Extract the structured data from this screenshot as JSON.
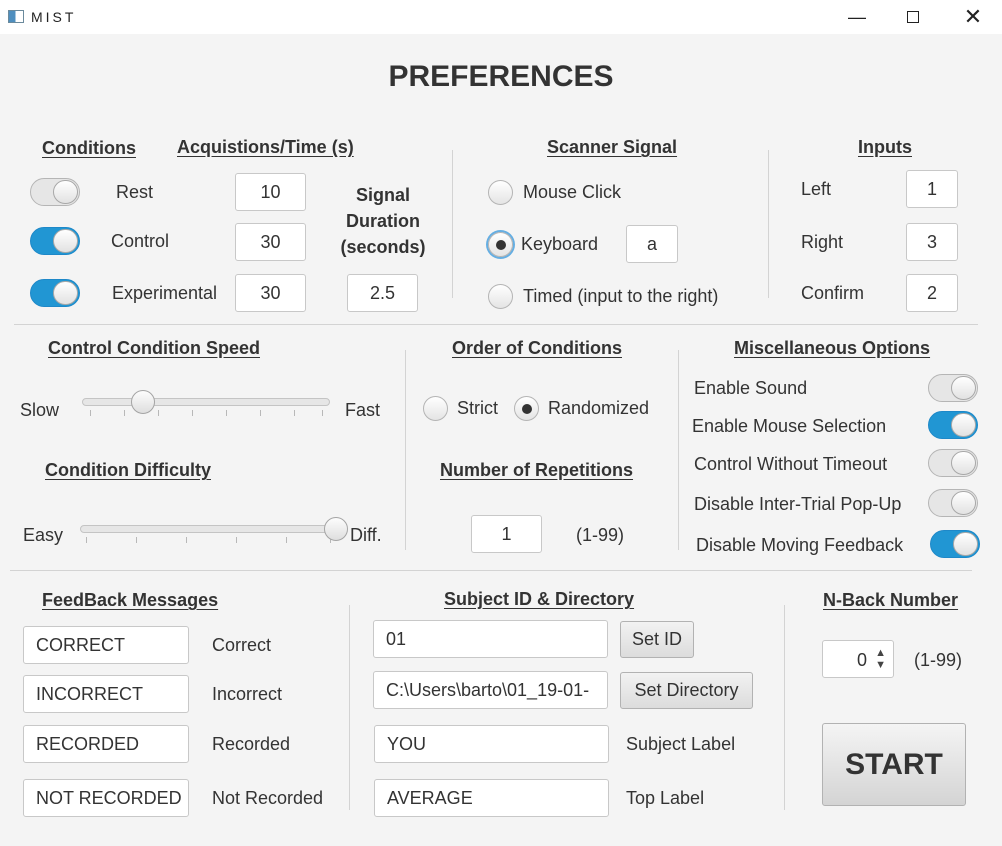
{
  "window": {
    "title": "MIST"
  },
  "page_title": "PREFERENCES",
  "conditions": {
    "heading": "Conditions",
    "acq_heading": "Acquistions/Time (s)",
    "rows": [
      {
        "label": "Rest",
        "value": "10",
        "enabled": false
      },
      {
        "label": "Control",
        "value": "30",
        "enabled": true
      },
      {
        "label": "Experimental",
        "value": "30",
        "enabled": true
      }
    ],
    "signal_duration_label": [
      "Signal",
      "Duration",
      "(seconds)"
    ],
    "signal_duration_value": "2.5"
  },
  "scanner_signal": {
    "heading": "Scanner Signal",
    "options": [
      "Mouse Click",
      "Keyboard",
      "Timed (input to the right)"
    ],
    "selected": "Keyboard",
    "keyboard_key": "a"
  },
  "inputs": {
    "heading": "Inputs",
    "rows": [
      {
        "label": "Left",
        "value": "1"
      },
      {
        "label": "Right",
        "value": "3"
      },
      {
        "label": "Confirm",
        "value": "2"
      }
    ]
  },
  "speed": {
    "heading": "Control Condition Speed",
    "min_label": "Slow",
    "max_label": "Fast",
    "value_fraction": 0.22
  },
  "difficulty": {
    "heading": "Condition Difficulty",
    "min_label": "Easy",
    "max_label": "Diff.",
    "value_fraction": 1.0
  },
  "order": {
    "heading": "Order of Conditions",
    "options": [
      "Strict",
      "Randomized"
    ],
    "selected": "Randomized"
  },
  "repetitions": {
    "heading": "Number of Repetitions",
    "value": "1",
    "range": "(1-99)"
  },
  "misc": {
    "heading": "Miscellaneous Options",
    "options": [
      {
        "label": "Enable Sound",
        "enabled": false
      },
      {
        "label": "Enable Mouse Selection",
        "enabled": true
      },
      {
        "label": "Control Without Timeout",
        "enabled": false
      },
      {
        "label": "Disable Inter-Trial Pop-Up",
        "enabled": false
      },
      {
        "label": "Disable Moving Feedback",
        "enabled": true
      }
    ]
  },
  "feedback": {
    "heading": "FeedBack Messages",
    "rows": [
      {
        "value": "CORRECT",
        "label": "Correct"
      },
      {
        "value": "INCORRECT",
        "label": "Incorrect"
      },
      {
        "value": "RECORDED",
        "label": "Recorded"
      },
      {
        "value": "NOT RECORDED",
        "label": "Not Recorded"
      }
    ]
  },
  "subject": {
    "heading": "Subject ID & Directory",
    "id_value": "01",
    "set_id_label": "Set ID",
    "directory_value": "C:\\Users\\barto\\01_19-01-",
    "set_directory_label": "Set Directory",
    "subject_label_value": "YOU",
    "subject_label_caption": "Subject Label",
    "top_label_value": "AVERAGE",
    "top_label_caption": "Top Label"
  },
  "nback": {
    "heading": "N-Back Number",
    "value": "0",
    "range": "(1-99)"
  },
  "start_label": "START",
  "colors": {
    "accent": "#2196d3",
    "background": "#f4f4f4"
  }
}
